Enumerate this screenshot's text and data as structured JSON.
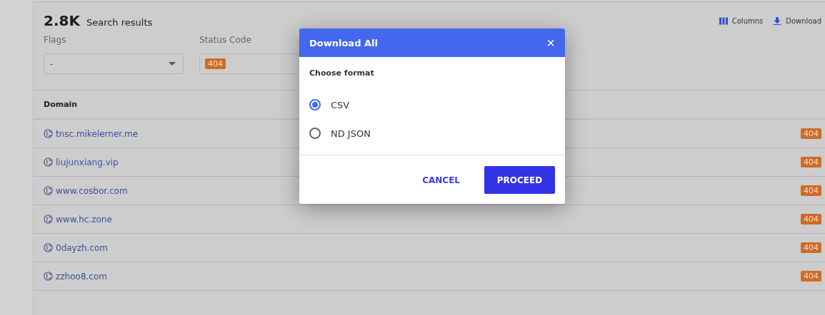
{
  "header": {
    "count": "2.8K",
    "label": "Search results",
    "actions": [
      {
        "kind": "columns",
        "label": "Columns"
      },
      {
        "kind": "download",
        "label": "Download"
      }
    ]
  },
  "filters": [
    {
      "kind": "select",
      "label": "Flags",
      "value": "-"
    },
    {
      "kind": "tags",
      "label": "Status Code",
      "tags": [
        "404"
      ]
    }
  ],
  "table": {
    "columns": [
      "Domain"
    ],
    "rows": [
      {
        "domain": "tnsc.mikelerner.me",
        "status": "404"
      },
      {
        "domain": "liujunxiang.vip",
        "status": "404"
      },
      {
        "domain": "www.cosbor.com",
        "status": "404"
      },
      {
        "domain": "www.hc.zone",
        "status": "404"
      },
      {
        "domain": "0dayzh.com",
        "status": "404"
      },
      {
        "domain": "zzhoo8.com",
        "status": "404"
      }
    ]
  },
  "dialog": {
    "title": "Download All",
    "close": "×",
    "prompt": "Choose format",
    "options": [
      {
        "label": "CSV",
        "selected": true
      },
      {
        "label": "ND JSON",
        "selected": false
      }
    ],
    "buttons": [
      {
        "kind": "text",
        "label": "CANCEL"
      },
      {
        "kind": "primary",
        "label": "PROCEED"
      }
    ]
  }
}
